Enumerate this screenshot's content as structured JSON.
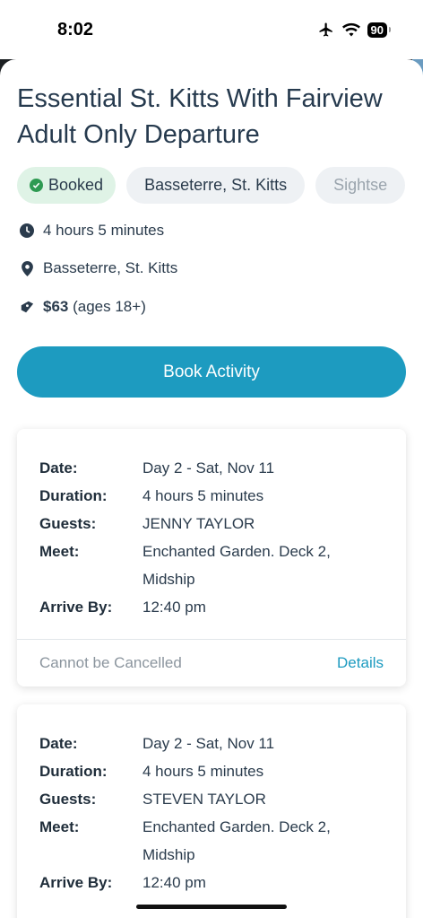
{
  "status": {
    "time": "8:02",
    "battery": "90"
  },
  "activity": {
    "title": "Essential St. Kitts With Fairview Adult Only Departure",
    "chips": [
      "Booked",
      "Basseterre, St. Kitts",
      "Sightse"
    ],
    "duration": "4 hours 5 minutes",
    "location": "Basseterre, St. Kitts",
    "price": "$63",
    "price_note": "(ages 18+)",
    "book_label": "Book Activity"
  },
  "labels": {
    "date": "Date:",
    "duration": "Duration:",
    "guests": "Guests:",
    "meet": "Meet:",
    "arrive": "Arrive By:"
  },
  "bookings": [
    {
      "date": "Day 2 - Sat, Nov 11",
      "duration": "4 hours 5 minutes",
      "guest": "JENNY TAYLOR",
      "meet": "Enchanted Garden. Deck 2, Midship",
      "arrive": "12:40 pm",
      "cancel_note": "Cannot be Cancelled",
      "details_label": "Details"
    },
    {
      "date": "Day 2 - Sat, Nov 11",
      "duration": "4 hours 5 minutes",
      "guest": "STEVEN TAYLOR",
      "meet": "Enchanted Garden. Deck 2, Midship",
      "arrive": "12:40 pm"
    }
  ],
  "colors": {
    "accent": "#1d9bc0",
    "booked_bg": "#dff3e6",
    "booked_icon": "#2e9a52"
  }
}
